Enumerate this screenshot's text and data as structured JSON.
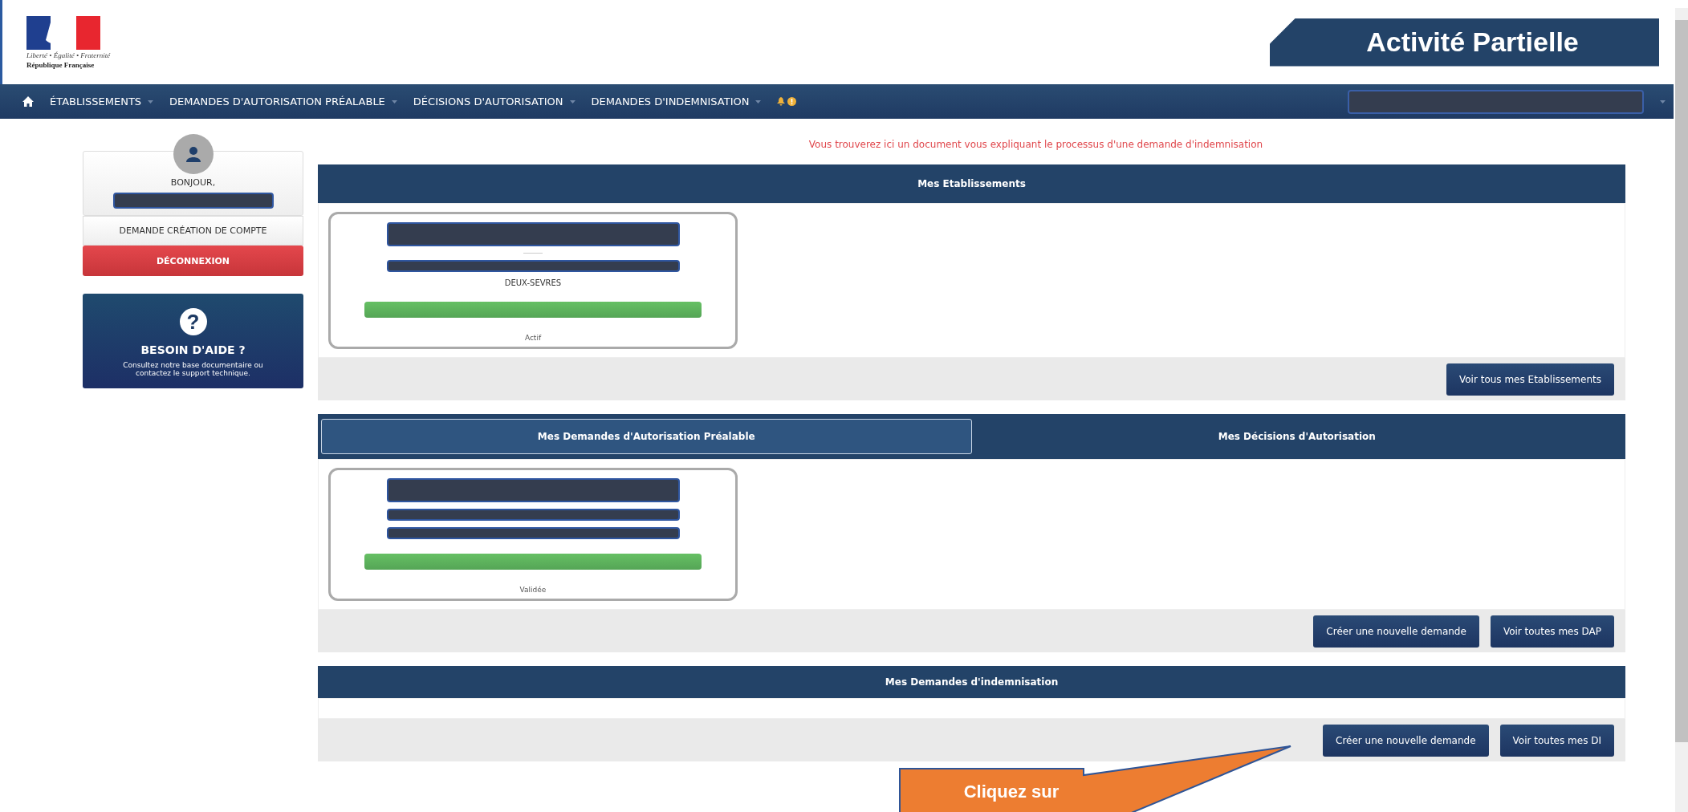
{
  "header": {
    "logo_motto": "Liberté • Égalité • Fraternité",
    "logo_name": "République Française",
    "title": "Activité Partielle"
  },
  "nav": {
    "items": [
      {
        "label": "ÉTABLISSEMENTS"
      },
      {
        "label": "DEMANDES D'AUTORISATION PRÉALABLE"
      },
      {
        "label": "DÉCISIONS D'AUTORISATION"
      },
      {
        "label": "DEMANDES D'INDEMNISATION"
      }
    ]
  },
  "sidebar": {
    "greeting": "BONJOUR,",
    "account_button": "DEMANDE CRÉATION DE COMPTE",
    "logout_button": "DÉCONNEXION",
    "help": {
      "icon": "?",
      "title": "BESOIN D'AIDE ?",
      "text": "Consultez notre base documentaire ou contactez le support technique."
    }
  },
  "notice": "Vous trouverez ici un document vous expliquant le processus d'une demande d'indemnisation",
  "establishments": {
    "title": "Mes Etablissements",
    "cards": [
      {
        "department": "DEUX-SEVRES",
        "status": "Actif",
        "level": 1
      }
    ],
    "buttons": [
      "Voir tous mes Etablissements"
    ]
  },
  "authorizations": {
    "tabs": [
      {
        "label": "Mes Demandes d'Autorisation Préalable",
        "selected": true
      },
      {
        "label": "Mes Décisions d'Autorisation",
        "selected": false
      }
    ],
    "cards": [
      {
        "status": "Validée",
        "level": 1
      }
    ],
    "buttons": [
      "Créer une nouvelle demande",
      "Voir toutes mes DAP"
    ]
  },
  "indemnities": {
    "title": "Mes Demandes d'indemnisation",
    "buttons": [
      "Créer une nouvelle demande",
      "Voir toutes mes DI"
    ]
  },
  "callout": {
    "text": "Cliquez sur"
  }
}
